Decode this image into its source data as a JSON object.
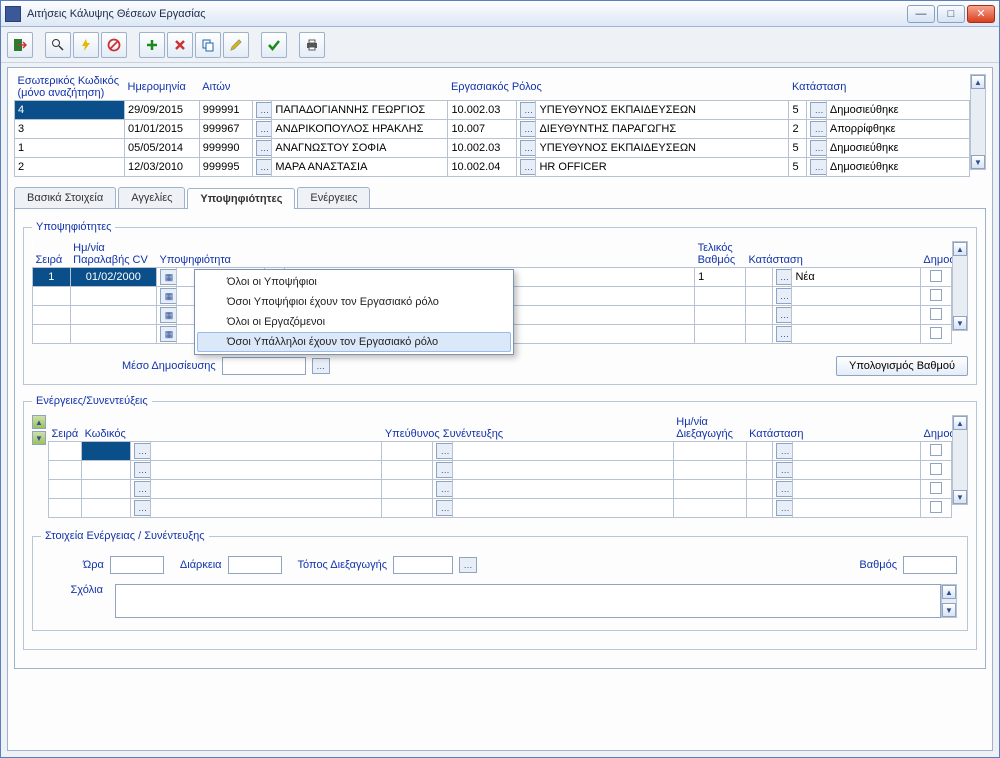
{
  "window": {
    "title": "Αιτήσεις Κάλυψης Θέσεων Εργασίας"
  },
  "master": {
    "cols": {
      "code": "Εσωτερικός Κωδικός\n(μόνο αναζήτηση)",
      "code1": "Εσωτερικός Κωδικός",
      "code2": "(μόνο αναζήτηση)",
      "date": "Ημερομηνία",
      "requester": "Αιτών",
      "role": "Εργασιακός Ρόλος",
      "status": "Κατάσταση"
    },
    "rows": [
      {
        "code": "4",
        "date": "29/09/2015",
        "req": "999991",
        "reqname": "ΠΑΠΑΔΟΓΙΑΝΝΗΣ ΓΕΩΡΓΙΟΣ",
        "rolecode": "10.002.03",
        "rolename": "ΥΠΕΥΘΥΝΟΣ ΕΚΠΑΙΔΕΥΣΕΩΝ",
        "stcode": "5",
        "stname": "Δημοσιεύθηκε"
      },
      {
        "code": "3",
        "date": "01/01/2015",
        "req": "999967",
        "reqname": "ΑΝΔΡΙΚΟΠΟΥΛΟΣ ΗΡΑΚΛΗΣ",
        "rolecode": "10.007",
        "rolename": "ΔΙΕΥΘΥΝΤΗΣ ΠΑΡΑΓΩΓΗΣ",
        "stcode": "2",
        "stname": "Απορρίφθηκε"
      },
      {
        "code": "1",
        "date": "05/05/2014",
        "req": "999990",
        "reqname": "ΑΝΑΓΝΩΣΤΟΥ ΣΟΦΙΑ",
        "rolecode": "10.002.03",
        "rolename": "ΥΠΕΥΘΥΝΟΣ ΕΚΠΑΙΔΕΥΣΕΩΝ",
        "stcode": "5",
        "stname": "Δημοσιεύθηκε"
      },
      {
        "code": "2",
        "date": "12/03/2010",
        "req": "999995",
        "reqname": "ΜΑΡΑ ΑΝΑΣΤΑΣΙΑ",
        "rolecode": "10.002.04",
        "rolename": "HR OFFICER",
        "stcode": "5",
        "stname": "Δημοσιεύθηκε"
      }
    ]
  },
  "tabs": {
    "t1": "Βασικά Στοιχεία",
    "t2": "Αγγελίες",
    "t3": "Υποψηφιότητες",
    "t4": "Ενέργειες"
  },
  "cand": {
    "legend": "Υποψηφιότητες",
    "cols": {
      "order": "Σειρά",
      "cvdate1": "Ημ/νία",
      "cvdate2": "Παραλαβής CV",
      "cand": "Υποψηφιότητα",
      "final1": "Τελικός",
      "final2": "Βαθμός",
      "status": "Κατάσταση",
      "publish": "Δημοσίευση"
    },
    "row": {
      "order": "1",
      "cvdate": "01/02/2000",
      "score": "1",
      "stname": "Νέα"
    },
    "medium_label": "Μέσο Δημοσίευσης",
    "calc_btn": "Υπολογισμός Βαθμού"
  },
  "context": {
    "m1": "Όλοι οι Υποψήφιοι",
    "m2": "Όσοι Υποψήφιοι έχουν τον Εργασιακό ρόλο",
    "m3": "Όλοι οι Εργαζόμενοι",
    "m4": "Όσοι Υπάλληλοι έχουν τον Εργασιακό ρόλο"
  },
  "actions": {
    "legend": "Ενέργειες/Συνεντεύξεις",
    "cols": {
      "order": "Σειρά",
      "code": "Κωδικός",
      "resp": "Υπεύθυνος Συνέντευξης",
      "date1": "Ημ/νία",
      "date2": "Διεξαγωγής",
      "status": "Κατάσταση",
      "publish": "Δημοσίευση"
    }
  },
  "detail": {
    "legend": "Στοιχεία Ενέργειας / Συνέντευξης",
    "time": "Ώρα",
    "dur": "Διάρκεια",
    "place": "Τόπος Διεξαγωγής",
    "score": "Βαθμός",
    "notes": "Σχόλια"
  }
}
